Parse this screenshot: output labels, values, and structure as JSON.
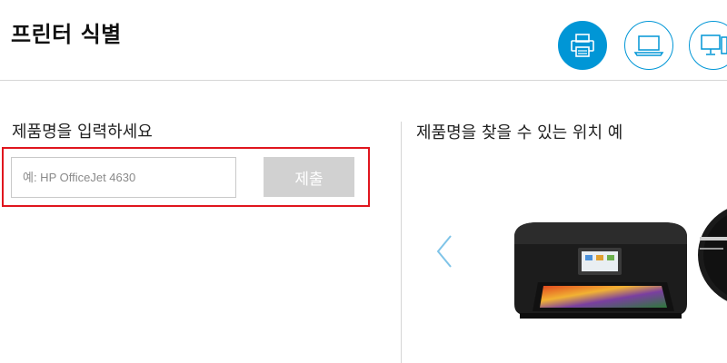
{
  "header": {
    "title": "프린터 식별",
    "devices": [
      {
        "icon": "printer-icon",
        "active": true
      },
      {
        "icon": "laptop-icon",
        "active": false
      },
      {
        "icon": "desktop-icon",
        "active": false
      }
    ]
  },
  "form": {
    "label": "제품명을 입력하세요",
    "input_placeholder": "예: HP OfficeJet 4630",
    "input_value": "",
    "submit_label": "제출"
  },
  "location": {
    "title": "제품명을 찾을 수 있는 위치 예"
  },
  "colors": {
    "accent": "#0096d6",
    "highlight": "#e0161e",
    "submit_disabled": "#d1d1d1",
    "divider": "#d6d6d6"
  }
}
